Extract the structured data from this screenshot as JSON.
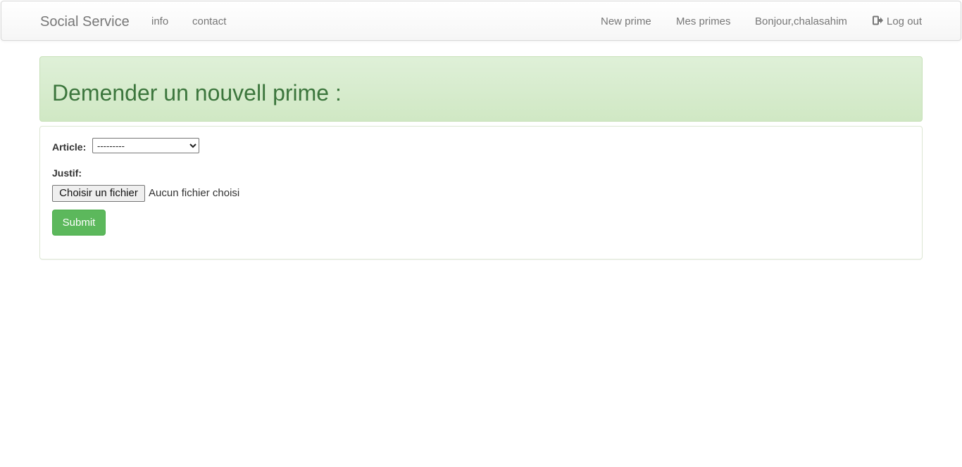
{
  "navbar": {
    "brand": "Social Service",
    "left_links": [
      {
        "label": "info"
      },
      {
        "label": "contact"
      }
    ],
    "right_links": [
      {
        "label": "New prime"
      },
      {
        "label": "Mes primes"
      },
      {
        "label": "Bonjour,chalasahim"
      },
      {
        "label": "Log out",
        "icon": "log-out-icon"
      }
    ]
  },
  "alert": {
    "title": "Demender un nouvell prime :",
    "color": "#3c763d",
    "background": "#dff0d8"
  },
  "form": {
    "article_label": "Article:",
    "article_selected": "---------",
    "justif_label": "Justif:",
    "file_button_label": "Choisir un fichier",
    "file_status": "Aucun fichier choisi",
    "submit_label": "Submit",
    "submit_color": "#5cb85c"
  }
}
